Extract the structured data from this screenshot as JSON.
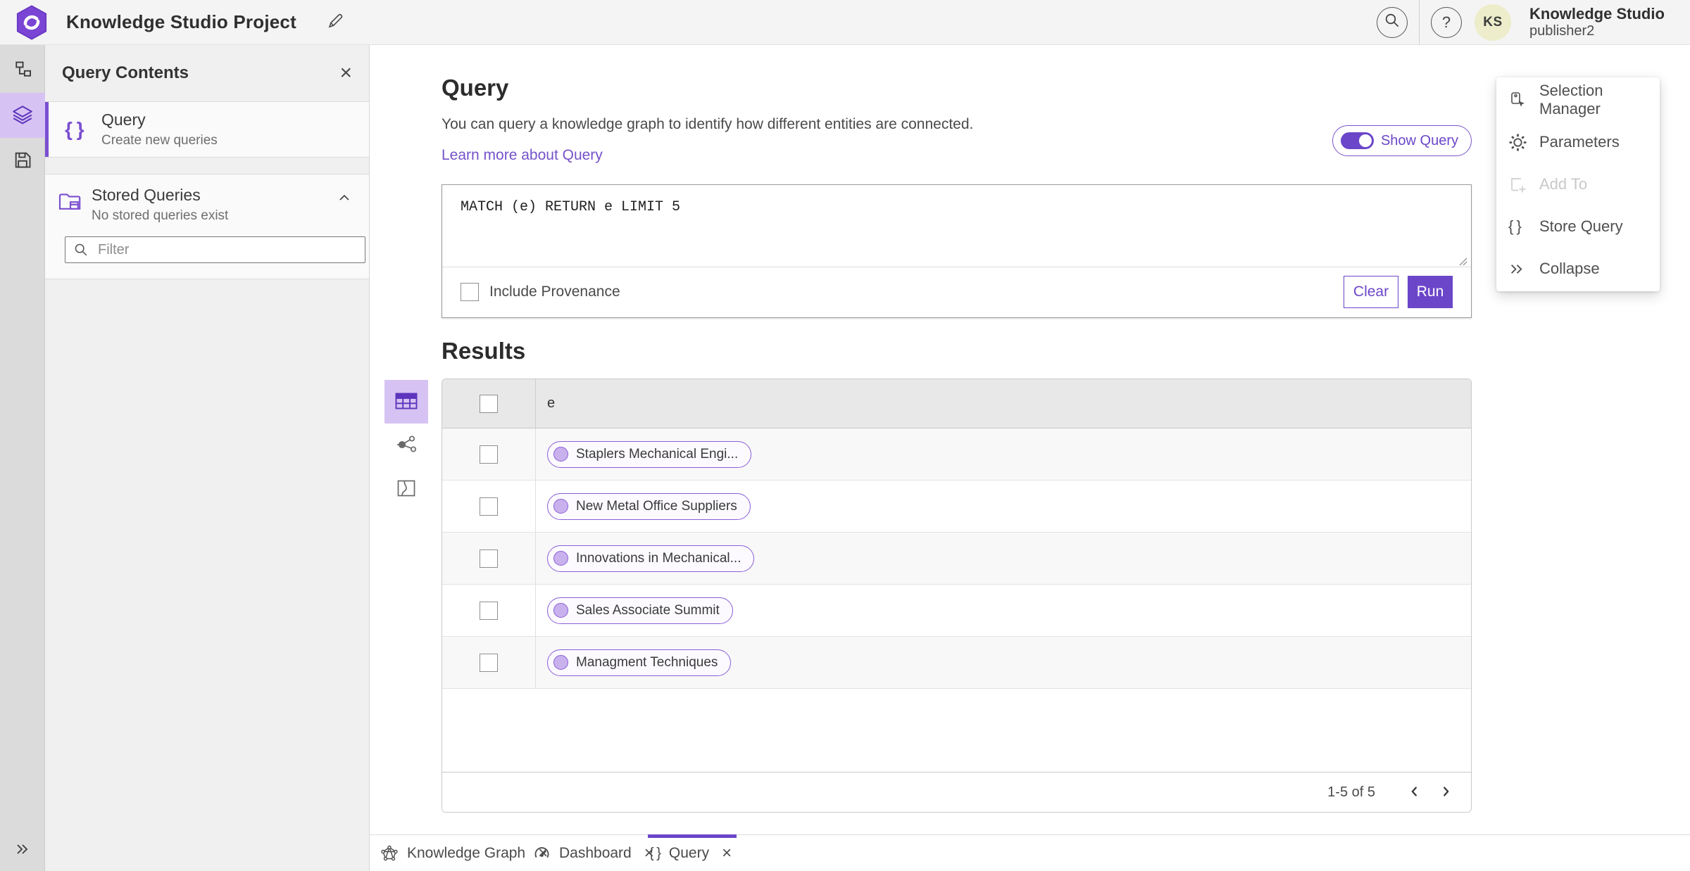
{
  "colors": {
    "accent": "#6b46c9",
    "accent_icon": "#5d34bd",
    "accent_light": "#d7c3f3",
    "link": "#7452c9"
  },
  "icons": {
    "close": "×",
    "help": "?",
    "braces": "{ }"
  },
  "header": {
    "project_title": "Knowledge Studio Project",
    "app_name": "Knowledge Studio",
    "user_name": "publisher2",
    "avatar_initials": "KS"
  },
  "rail": {
    "items": [
      {
        "icon": "hierarchy",
        "active": false
      },
      {
        "icon": "layers",
        "active": true
      },
      {
        "icon": "save",
        "active": false
      }
    ]
  },
  "contents_panel": {
    "title": "Query Contents",
    "query_item": {
      "label": "Query",
      "description": "Create new queries"
    },
    "stored_item": {
      "label": "Stored Queries",
      "description": "No stored queries exist"
    },
    "filter_placeholder": "Filter"
  },
  "query_section": {
    "heading": "Query",
    "description": "You can query a knowledge graph to identify how different entities are connected.",
    "learn_more_label": "Learn more about Query",
    "show_query_label": "Show Query",
    "show_query_on": true,
    "query_text": "MATCH (e) RETURN e LIMIT 5",
    "include_provenance_label": "Include Provenance",
    "include_provenance_checked": false,
    "clear_label": "Clear",
    "run_label": "Run"
  },
  "results": {
    "heading": "Results",
    "column_header": "e",
    "rows": [
      "Staplers Mechanical Engi...",
      "New Metal Office Suppliers",
      "Innovations in Mechanical...",
      "Sales Associate Summit",
      "Managment Techniques"
    ],
    "pagination_label": "1-5 of 5",
    "view_modes": [
      "table",
      "link-chart",
      "map"
    ],
    "active_view": "table"
  },
  "context_menu": {
    "items": [
      {
        "label": "Selection Manager",
        "icon": "selection-manager",
        "disabled": false
      },
      {
        "label": "Parameters",
        "icon": "gear",
        "disabled": false
      },
      {
        "label": "Add To",
        "icon": "add-to",
        "disabled": true
      },
      {
        "label": "Store Query",
        "icon": "braces",
        "disabled": false
      },
      {
        "label": "Collapse",
        "icon": "double-chevron-right",
        "disabled": false
      }
    ]
  },
  "tabs": [
    {
      "label": "Knowledge Graph",
      "icon": "graph",
      "active": false
    },
    {
      "label": "Dashboard",
      "icon": "gauge",
      "active": false
    },
    {
      "label": "Query",
      "icon": "braces",
      "active": true
    }
  ]
}
